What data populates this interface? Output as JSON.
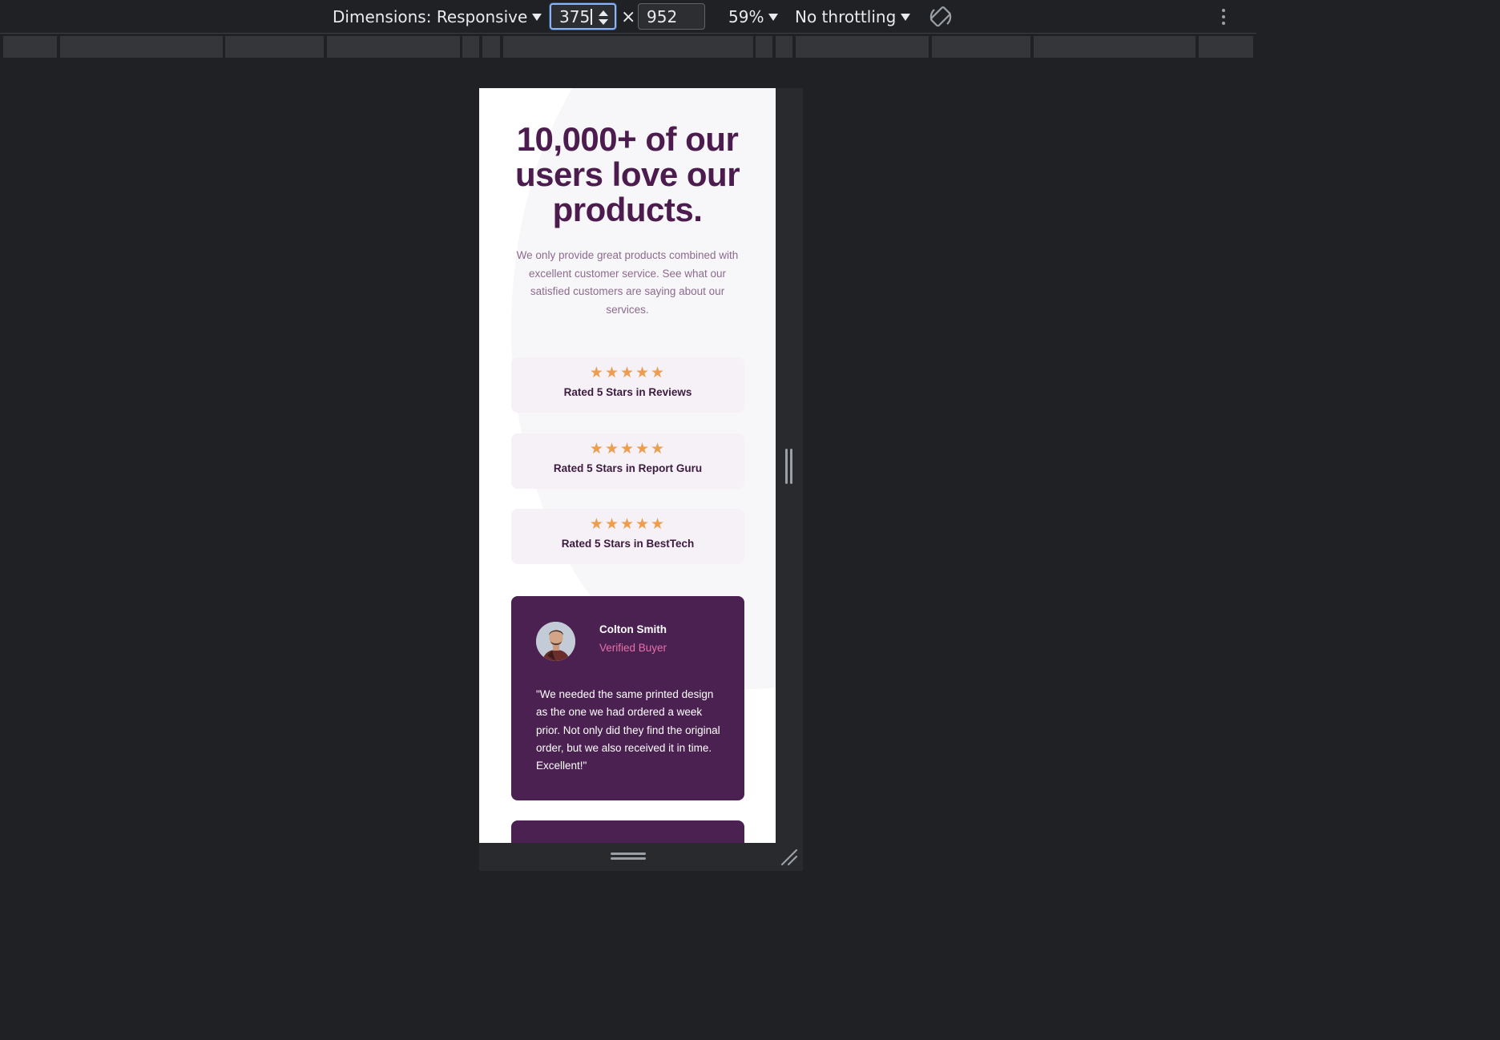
{
  "devtools": {
    "dimensions_label": "Dimensions: Responsive",
    "width_value": "375",
    "times_symbol": "×",
    "height_value": "952",
    "zoom": "59%",
    "throttling": "No throttling"
  },
  "page": {
    "headline": "10,000+ of our users love our products.",
    "subtext": "We only provide great products combined with excellent customer service. See what our satisfied customers are saying about our services.",
    "ratings": [
      {
        "stars": "★★★★★",
        "label": "Rated 5 Stars in Reviews"
      },
      {
        "stars": "★★★★★",
        "label": "Rated 5 Stars in Report Guru"
      },
      {
        "stars": "★★★★★",
        "label": "Rated 5 Stars in BestTech"
      }
    ],
    "testimonials": [
      {
        "name": "Colton Smith",
        "role": "Verified Buyer",
        "quote": "\"We needed the same printed design as the one we had ordered a week prior. Not only did they find the original order, but we also received it in time. Excellent!\""
      }
    ]
  },
  "colors": {
    "heading": "#4b1c4d",
    "subtext": "#8c6b8e",
    "star": "#ee9d4e",
    "rating_bg": "#f6f1f7",
    "testimonial_bg": "#4a2151",
    "role_accent": "#e771a7"
  }
}
